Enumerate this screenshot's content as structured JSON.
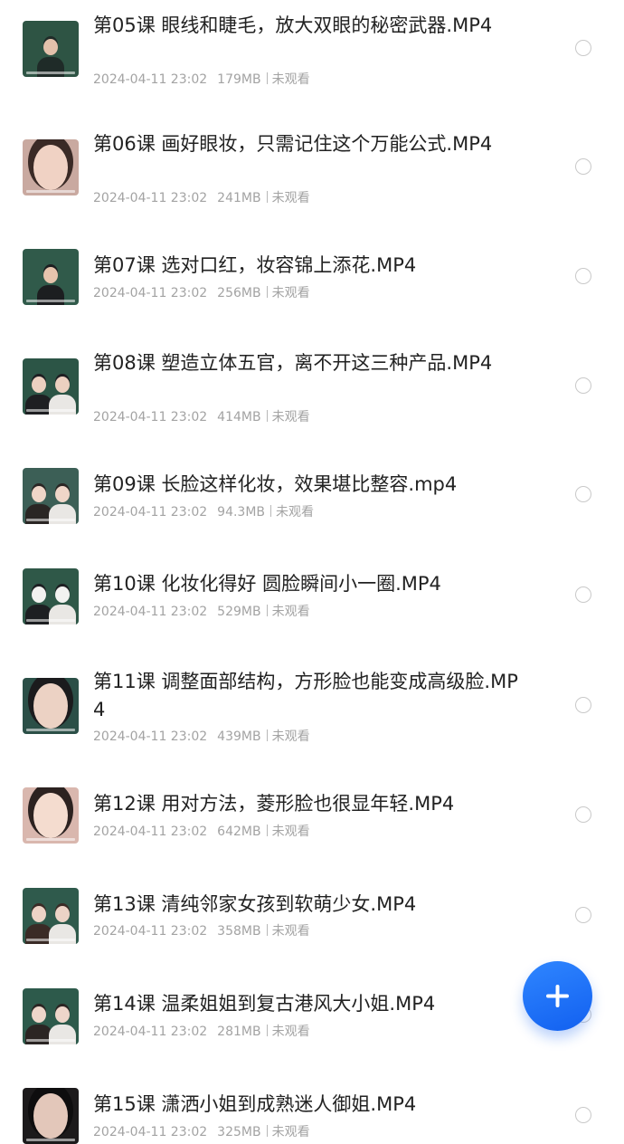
{
  "file_list": {
    "items": [
      {
        "title": "第05课 眼线和睫毛，放大双眼的秘密武器.MP4",
        "date": "2024-04-11 23:02",
        "size": "179MB",
        "status": "未观看",
        "thumb_colors": {
          "bg": "#2e5444",
          "accent": "#1f2b28",
          "skin": "#e3c1ab"
        }
      },
      {
        "title": "第06课 画好眼妆，只需记住这个万能公式.MP4",
        "date": "2024-04-11 23:02",
        "size": "241MB",
        "status": "未观看",
        "thumb_colors": {
          "bg": "#c9a9a0",
          "accent": "#3a2a26",
          "skin": "#f0d2c4"
        }
      },
      {
        "title": "第07课 选对口红，妆容锦上添花.MP4",
        "date": "2024-04-11 23:02",
        "size": "256MB",
        "status": "未观看",
        "thumb_colors": {
          "bg": "#305a4a",
          "accent": "#1c1e20",
          "skin": "#e6c4ad"
        }
      },
      {
        "title": "第08课 塑造立体五官，离不开这三种产品.MP4",
        "date": "2024-04-11 23:02",
        "size": "414MB",
        "status": "未观看",
        "thumb_colors": {
          "bg": "#2c5546",
          "accent": "#1e1f22",
          "skin": "#ecd0c0"
        }
      },
      {
        "title": "第09课 长脸这样化妆，效果堪比整容.mp4",
        "date": "2024-04-11 23:02",
        "size": "94.3MB",
        "status": "未观看",
        "thumb_colors": {
          "bg": "#3c5f56",
          "accent": "#2a2624",
          "skin": "#efd6c8"
        }
      },
      {
        "title": "第10课 化妆化得好 圆脸瞬间小一圈.MP4",
        "date": "2024-04-11 23:02",
        "size": "529MB",
        "status": "未观看",
        "thumb_colors": {
          "bg": "#2f5848",
          "accent": "#1d1f22",
          "skin": "#f2f2f0"
        }
      },
      {
        "title": "第11课 调整面部结构，方形脸也能变成高级脸.MP4",
        "date": "2024-04-11 23:02",
        "size": "439MB",
        "status": "未观看",
        "thumb_colors": {
          "bg": "#2b4f47",
          "accent": "#1b1b1d",
          "skin": "#ecd2c4"
        }
      },
      {
        "title": "第12课 用对方法，菱形脸也很显年轻.MP4",
        "date": "2024-04-11 23:02",
        "size": "642MB",
        "status": "未观看",
        "thumb_colors": {
          "bg": "#d9b7ae",
          "accent": "#2c2220",
          "skin": "#f4dccf"
        }
      },
      {
        "title": "第13课 清纯邻家女孩到软萌少女.MP4",
        "date": "2024-04-11 23:02",
        "size": "358MB",
        "status": "未观看",
        "thumb_colors": {
          "bg": "#2f5a4c",
          "accent": "#3a2b26",
          "skin": "#ecd3c6"
        }
      },
      {
        "title": "第14课 温柔姐姐到复古港风大小姐.MP4",
        "date": "2024-04-11 23:02",
        "size": "281MB",
        "status": "未观看",
        "thumb_colors": {
          "bg": "#2d5a4b",
          "accent": "#2b2523",
          "skin": "#eed6ca"
        }
      },
      {
        "title": "第15课 潇洒小姐到成熟迷人御姐.MP4",
        "date": "2024-04-11 23:02",
        "size": "325MB",
        "status": "未观看",
        "thumb_colors": {
          "bg": "#1c1a1b",
          "accent": "#0e0d0e",
          "skin": "#e3c7ba"
        }
      }
    ]
  },
  "fab": {
    "icon": "plus-icon",
    "color": "#1e6ff5"
  }
}
